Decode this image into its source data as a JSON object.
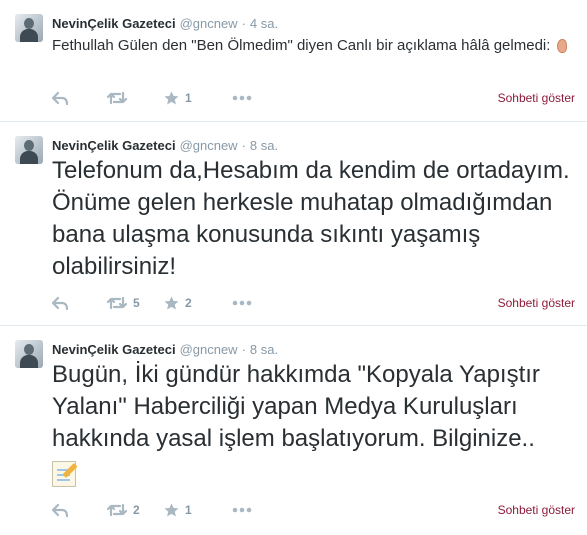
{
  "tweets": [
    {
      "name": "NevinÇelik Gazeteci",
      "handle": "@gncnew",
      "time": "4 sa.",
      "text": "Fethullah Gülen den \"Ben Ölmedim\" diyen Canlı bir açıklama hâlâ gelmedi:",
      "emoji_icon": "ear-icon",
      "retweets": "",
      "favorites": "1",
      "conversation_label": "Sohbeti göster"
    },
    {
      "name": "NevinÇelik Gazeteci",
      "handle": "@gncnew",
      "time": "8 sa.",
      "text": "Telefonum da,Hesabım da kendim de ortadayım. Önüme gelen herkesle muhatap olmadığımdan bana ulaşma konusunda sıkıntı yaşamış olabilirsiniz!",
      "retweets": "5",
      "favorites": "2",
      "conversation_label": "Sohbeti göster"
    },
    {
      "name": "NevinÇelik Gazeteci",
      "handle": "@gncnew",
      "time": "8 sa.",
      "text": "Bugün, İki gündür hakkımda \"Kopyala Yapıştır Yalanı\" Haberciliği yapan Medya Kuruluşları hakkında yasal işlem başlatıyorum. Bilginize..",
      "emoji_icon": "memo-icon",
      "retweets": "2",
      "favorites": "1",
      "conversation_label": "Sohbeti göster"
    }
  ],
  "colors": {
    "text": "#292f33",
    "muted": "#8899a6",
    "link": "#8e1b3a",
    "divider": "#e1e8ed"
  }
}
